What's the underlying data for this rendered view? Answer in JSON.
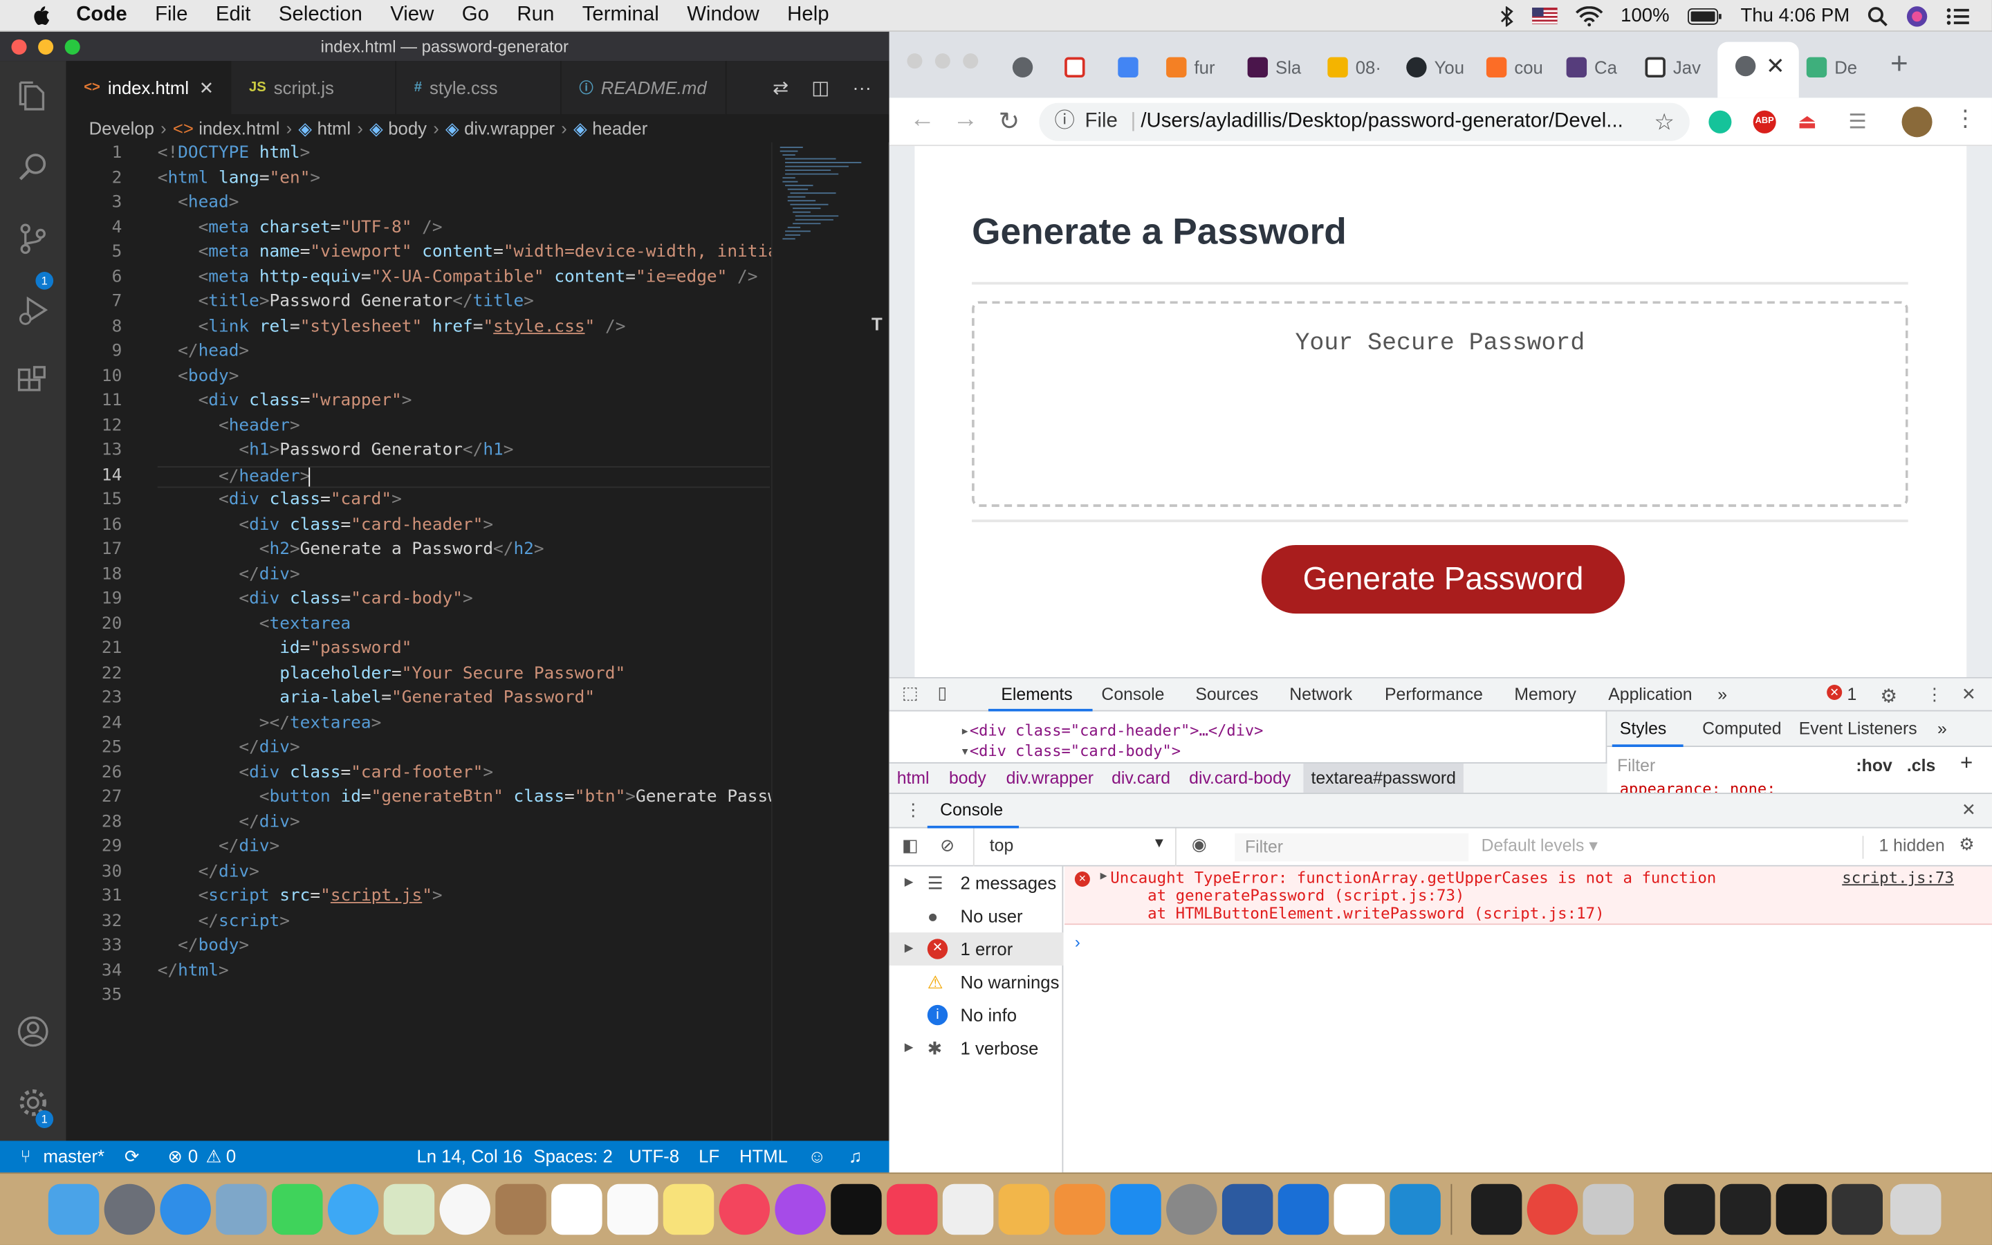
{
  "menubar": {
    "app_name": "Code",
    "items": [
      "File",
      "Edit",
      "Selection",
      "View",
      "Go",
      "Run",
      "Terminal",
      "Window",
      "Help"
    ],
    "battery": "100%",
    "clock": "Thu 4:06 PM"
  },
  "vscode": {
    "window_title": "index.html — password-generator",
    "tabs": [
      {
        "icon": "<>",
        "label": "index.html"
      },
      {
        "icon": "JS",
        "label": "script.js"
      },
      {
        "icon": "#",
        "label": "style.css"
      },
      {
        "icon": "ⓘ",
        "label": "README.md"
      }
    ],
    "breadcrumb": [
      "Develop",
      "index.html",
      "html",
      "body",
      "div.wrapper",
      "header"
    ],
    "source_control_badge": "1",
    "settings_badge": "1",
    "status": {
      "branch": "master*",
      "problems": "0",
      "warnings": "0",
      "cursor": "Ln 14, Col 16",
      "spaces": "Spaces: 2",
      "encoding": "UTF-8",
      "eol": "LF",
      "language": "HTML"
    }
  },
  "chrome": {
    "tabs": [
      "fur",
      "Sla",
      "08·",
      "You",
      "cou",
      "Ca",
      "Jav",
      "",
      "De"
    ],
    "url_scheme": "File",
    "url": "/Users/ayladillis/Desktop/password-generator/Devel...",
    "page": {
      "card_title": "Generate a Password",
      "password_placeholder": "Your Secure Password",
      "button_label": "Generate Password"
    },
    "devtools": {
      "tabs": [
        "Elements",
        "Console",
        "Sources",
        "Network",
        "Performance",
        "Memory",
        "Application"
      ],
      "error_count": "1",
      "dom_lines": [
        "<div class=\"card-header\">…</div>",
        "<div class=\"card-body\">"
      ],
      "dom_crumbs": [
        "html",
        "body",
        "div.wrapper",
        "div.card",
        "div.card-body",
        "textarea#password"
      ],
      "styles_tabs": [
        "Styles",
        "Computed",
        "Event Listeners"
      ],
      "styles_filter": "Filter",
      "hov": ":hov",
      "cls": ".cls",
      "style_snippet": "appearance: none;",
      "drawer_tab": "Console",
      "context": "top",
      "filter_placeholder": "Filter",
      "levels": "Default levels ▾",
      "hidden": "1 hidden",
      "sidebar": [
        "2 messages",
        "No user me...",
        "1 error",
        "No warnings",
        "No info",
        "1 verbose"
      ],
      "error_lines": [
        "Uncaught TypeError: functionArray.getUpperCases is not a function",
        "    at generatePassword (script.js:73)",
        "    at HTMLButtonElement.writePassword (script.js:17)"
      ],
      "error_source": "script.js:73"
    }
  }
}
